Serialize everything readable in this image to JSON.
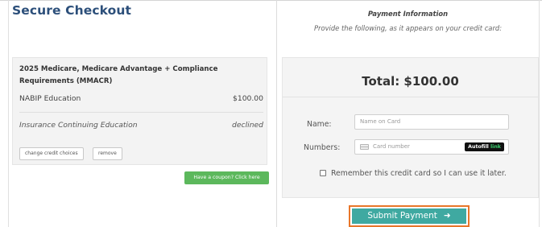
{
  "page": {
    "title": "Secure Checkout"
  },
  "cart": {
    "course_title": "2025 Medicare, Medicare Advantage + Compliance Requirements (MMACR)",
    "rows": [
      {
        "label": "NABIP Education",
        "value": "$100.00"
      },
      {
        "label": "Insurance Continuing Education",
        "value": "declined"
      }
    ],
    "change_label": "change credit choices",
    "remove_label": "remove"
  },
  "coupon": {
    "label": "Have a coupon? Click here"
  },
  "payment": {
    "heading": "Payment Information",
    "subheading": "Provide the following, as it appears on your credit card:",
    "total": "Total: $100.00",
    "name_label": "Name:",
    "name_placeholder": "Name on Card",
    "numbers_label": "Numbers:",
    "card_placeholder": "Card number",
    "autofill_label": "Autofill",
    "autofill_link": "link",
    "remember_label": "Remember this credit card so I can use it later.",
    "remember_checked": false,
    "submit_label": "Submit Payment",
    "submit_icon": "arrow-right-icon"
  },
  "colors": {
    "title": "#2c4f7a",
    "coupon_green": "#5cb85c",
    "submit_teal": "#3fa9a1",
    "highlight_orange": "#e8762a",
    "link_green": "#3bd16f"
  }
}
